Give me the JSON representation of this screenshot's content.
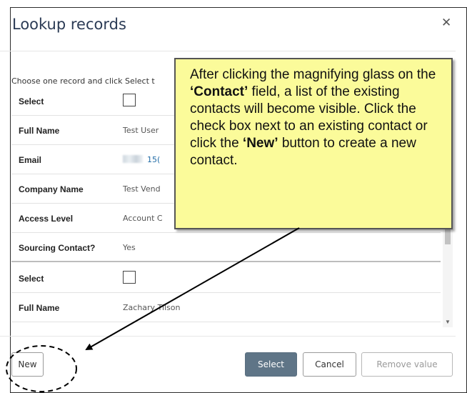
{
  "dialog": {
    "title": "Lookup records",
    "close_icon": "close-icon",
    "instruction": "Choose one record and click Select t"
  },
  "records": [
    {
      "type": "select",
      "label": "Select",
      "checked": false
    },
    {
      "type": "text",
      "label": "Full Name",
      "value": "Test User"
    },
    {
      "type": "email",
      "label": "Email",
      "value": "15("
    },
    {
      "type": "text",
      "label": "Company Name",
      "value": "Test Vend"
    },
    {
      "type": "text",
      "label": "Access Level",
      "value": "Account C"
    },
    {
      "type": "text",
      "label": "Sourcing Contact?",
      "value": "Yes"
    },
    {
      "type": "select",
      "label": "Select",
      "checked": false
    },
    {
      "type": "text",
      "label": "Full Name",
      "value": "Zachary Tilson"
    }
  ],
  "buttons": {
    "new": "New",
    "select": "Select",
    "cancel": "Cancel",
    "remove": "Remove value"
  },
  "callout": {
    "part1": "After clicking the magnifying glass on the ",
    "contact": "‘Contact’",
    "part2": " field, a list of the existing contacts will become visible. Click the check box next to an existing contact or click the ",
    "new": "‘New’",
    "part3": " button to create a new contact."
  },
  "colors": {
    "select_button": "#5f7587",
    "callout_background": "#fbfb9a",
    "link": "#1f6aa5"
  }
}
